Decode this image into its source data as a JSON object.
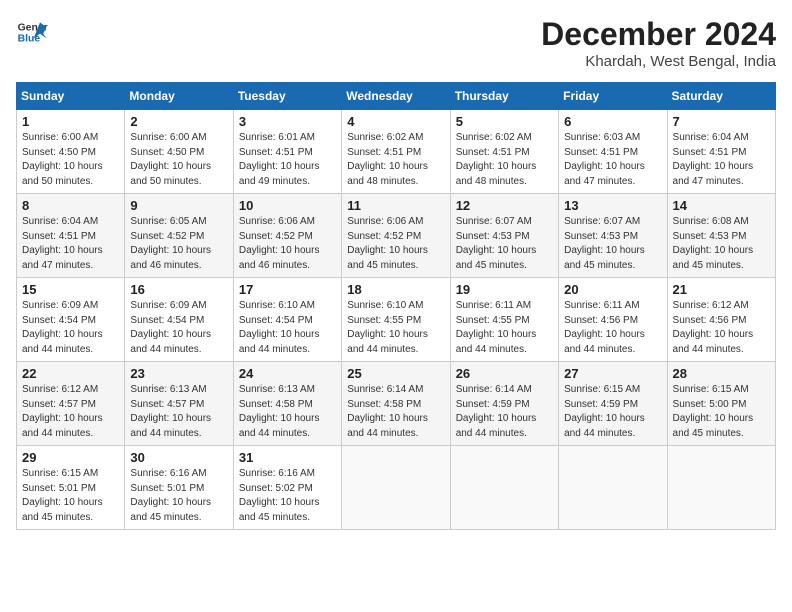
{
  "header": {
    "logo_line1": "General",
    "logo_line2": "Blue",
    "month": "December 2024",
    "location": "Khardah, West Bengal, India"
  },
  "weekdays": [
    "Sunday",
    "Monday",
    "Tuesday",
    "Wednesday",
    "Thursday",
    "Friday",
    "Saturday"
  ],
  "weeks": [
    [
      {
        "day": "1",
        "info": "Sunrise: 6:00 AM\nSunset: 4:50 PM\nDaylight: 10 hours\nand 50 minutes."
      },
      {
        "day": "2",
        "info": "Sunrise: 6:00 AM\nSunset: 4:50 PM\nDaylight: 10 hours\nand 50 minutes."
      },
      {
        "day": "3",
        "info": "Sunrise: 6:01 AM\nSunset: 4:51 PM\nDaylight: 10 hours\nand 49 minutes."
      },
      {
        "day": "4",
        "info": "Sunrise: 6:02 AM\nSunset: 4:51 PM\nDaylight: 10 hours\nand 48 minutes."
      },
      {
        "day": "5",
        "info": "Sunrise: 6:02 AM\nSunset: 4:51 PM\nDaylight: 10 hours\nand 48 minutes."
      },
      {
        "day": "6",
        "info": "Sunrise: 6:03 AM\nSunset: 4:51 PM\nDaylight: 10 hours\nand 47 minutes."
      },
      {
        "day": "7",
        "info": "Sunrise: 6:04 AM\nSunset: 4:51 PM\nDaylight: 10 hours\nand 47 minutes."
      }
    ],
    [
      {
        "day": "8",
        "info": "Sunrise: 6:04 AM\nSunset: 4:51 PM\nDaylight: 10 hours\nand 47 minutes."
      },
      {
        "day": "9",
        "info": "Sunrise: 6:05 AM\nSunset: 4:52 PM\nDaylight: 10 hours\nand 46 minutes."
      },
      {
        "day": "10",
        "info": "Sunrise: 6:06 AM\nSunset: 4:52 PM\nDaylight: 10 hours\nand 46 minutes."
      },
      {
        "day": "11",
        "info": "Sunrise: 6:06 AM\nSunset: 4:52 PM\nDaylight: 10 hours\nand 45 minutes."
      },
      {
        "day": "12",
        "info": "Sunrise: 6:07 AM\nSunset: 4:53 PM\nDaylight: 10 hours\nand 45 minutes."
      },
      {
        "day": "13",
        "info": "Sunrise: 6:07 AM\nSunset: 4:53 PM\nDaylight: 10 hours\nand 45 minutes."
      },
      {
        "day": "14",
        "info": "Sunrise: 6:08 AM\nSunset: 4:53 PM\nDaylight: 10 hours\nand 45 minutes."
      }
    ],
    [
      {
        "day": "15",
        "info": "Sunrise: 6:09 AM\nSunset: 4:54 PM\nDaylight: 10 hours\nand 44 minutes."
      },
      {
        "day": "16",
        "info": "Sunrise: 6:09 AM\nSunset: 4:54 PM\nDaylight: 10 hours\nand 44 minutes."
      },
      {
        "day": "17",
        "info": "Sunrise: 6:10 AM\nSunset: 4:54 PM\nDaylight: 10 hours\nand 44 minutes."
      },
      {
        "day": "18",
        "info": "Sunrise: 6:10 AM\nSunset: 4:55 PM\nDaylight: 10 hours\nand 44 minutes."
      },
      {
        "day": "19",
        "info": "Sunrise: 6:11 AM\nSunset: 4:55 PM\nDaylight: 10 hours\nand 44 minutes."
      },
      {
        "day": "20",
        "info": "Sunrise: 6:11 AM\nSunset: 4:56 PM\nDaylight: 10 hours\nand 44 minutes."
      },
      {
        "day": "21",
        "info": "Sunrise: 6:12 AM\nSunset: 4:56 PM\nDaylight: 10 hours\nand 44 minutes."
      }
    ],
    [
      {
        "day": "22",
        "info": "Sunrise: 6:12 AM\nSunset: 4:57 PM\nDaylight: 10 hours\nand 44 minutes."
      },
      {
        "day": "23",
        "info": "Sunrise: 6:13 AM\nSunset: 4:57 PM\nDaylight: 10 hours\nand 44 minutes."
      },
      {
        "day": "24",
        "info": "Sunrise: 6:13 AM\nSunset: 4:58 PM\nDaylight: 10 hours\nand 44 minutes."
      },
      {
        "day": "25",
        "info": "Sunrise: 6:14 AM\nSunset: 4:58 PM\nDaylight: 10 hours\nand 44 minutes."
      },
      {
        "day": "26",
        "info": "Sunrise: 6:14 AM\nSunset: 4:59 PM\nDaylight: 10 hours\nand 44 minutes."
      },
      {
        "day": "27",
        "info": "Sunrise: 6:15 AM\nSunset: 4:59 PM\nDaylight: 10 hours\nand 44 minutes."
      },
      {
        "day": "28",
        "info": "Sunrise: 6:15 AM\nSunset: 5:00 PM\nDaylight: 10 hours\nand 45 minutes."
      }
    ],
    [
      {
        "day": "29",
        "info": "Sunrise: 6:15 AM\nSunset: 5:01 PM\nDaylight: 10 hours\nand 45 minutes."
      },
      {
        "day": "30",
        "info": "Sunrise: 6:16 AM\nSunset: 5:01 PM\nDaylight: 10 hours\nand 45 minutes."
      },
      {
        "day": "31",
        "info": "Sunrise: 6:16 AM\nSunset: 5:02 PM\nDaylight: 10 hours\nand 45 minutes."
      },
      null,
      null,
      null,
      null
    ]
  ]
}
